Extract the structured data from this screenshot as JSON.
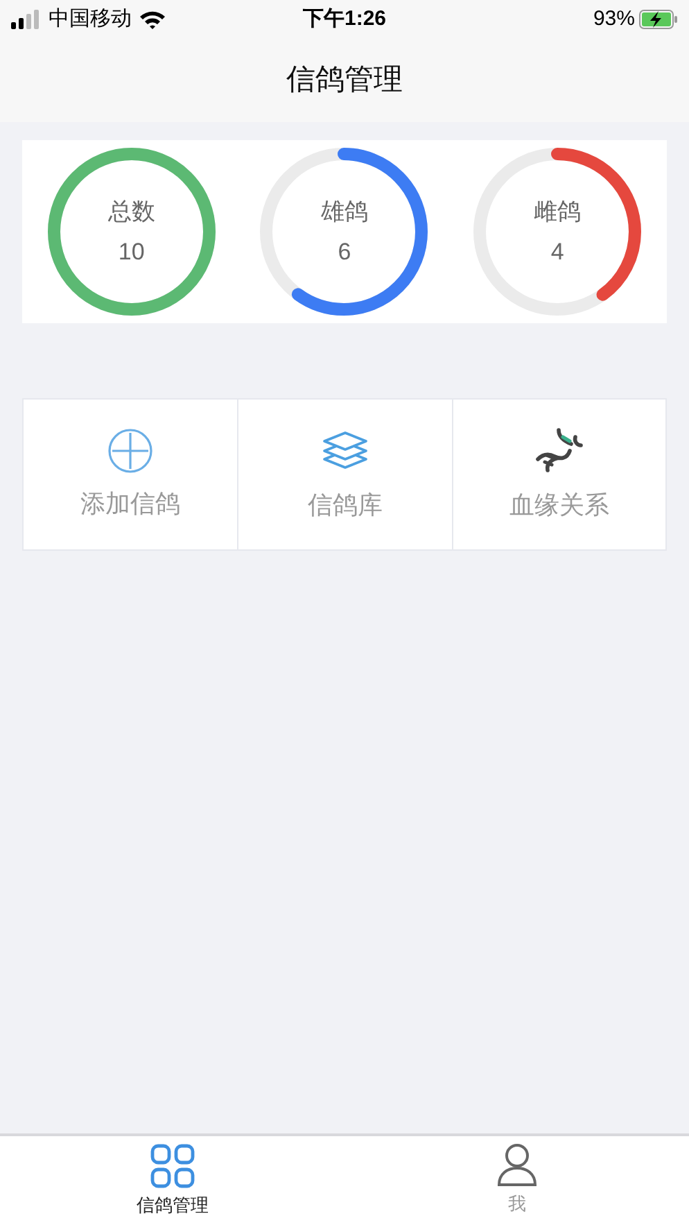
{
  "status_bar": {
    "carrier": "中国移动",
    "time": "下午1:26",
    "battery": "93%"
  },
  "header": {
    "title": "信鸽管理"
  },
  "stats": [
    {
      "label": "总数",
      "value": "10",
      "color": "#5cb973"
    },
    {
      "label": "雄鸽",
      "value": "6",
      "color": "#3d7cf3"
    },
    {
      "label": "雌鸽",
      "value": "4",
      "color": "#e5483e"
    }
  ],
  "menu": [
    {
      "kind": "add",
      "label": "添加信鸽"
    },
    {
      "kind": "library",
      "label": "信鸽库"
    },
    {
      "kind": "lineage",
      "label": "血缘关系"
    }
  ],
  "tabs": [
    {
      "kind": "grid",
      "label": "信鸽管理",
      "selected": true
    },
    {
      "kind": "person",
      "label": "我",
      "selected": false
    }
  ]
}
